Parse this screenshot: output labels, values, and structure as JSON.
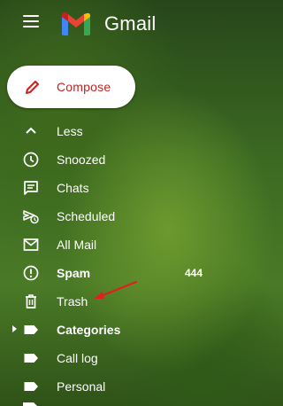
{
  "header": {
    "brand": "Gmail",
    "menu_icon": "hamburger-menu-icon",
    "logo_icon": "gmail-logo-icon"
  },
  "compose": {
    "label": "Compose",
    "icon": "pencil-icon"
  },
  "nav": {
    "items": [
      {
        "label": "Less",
        "icon": "chevron-up-icon",
        "bold": false
      },
      {
        "label": "Snoozed",
        "icon": "clock-icon",
        "bold": false
      },
      {
        "label": "Chats",
        "icon": "chat-icon",
        "bold": false
      },
      {
        "label": "Scheduled",
        "icon": "scheduled-send-icon",
        "bold": false
      },
      {
        "label": "All Mail",
        "icon": "mail-icon",
        "bold": false
      },
      {
        "label": "Spam",
        "icon": "spam-icon",
        "bold": true,
        "count": "444"
      },
      {
        "label": "Trash",
        "icon": "trash-icon",
        "bold": false
      },
      {
        "label": "Categories",
        "icon": "label-icon",
        "bold": true
      },
      {
        "label": "Call log",
        "icon": "label-icon",
        "bold": false
      },
      {
        "label": "Personal",
        "icon": "label-icon",
        "bold": false
      }
    ]
  },
  "annotation": {
    "arrow_color": "#e02020"
  },
  "colors": {
    "compose_text": "#c5221f",
    "nav_text": "#ffffff"
  }
}
